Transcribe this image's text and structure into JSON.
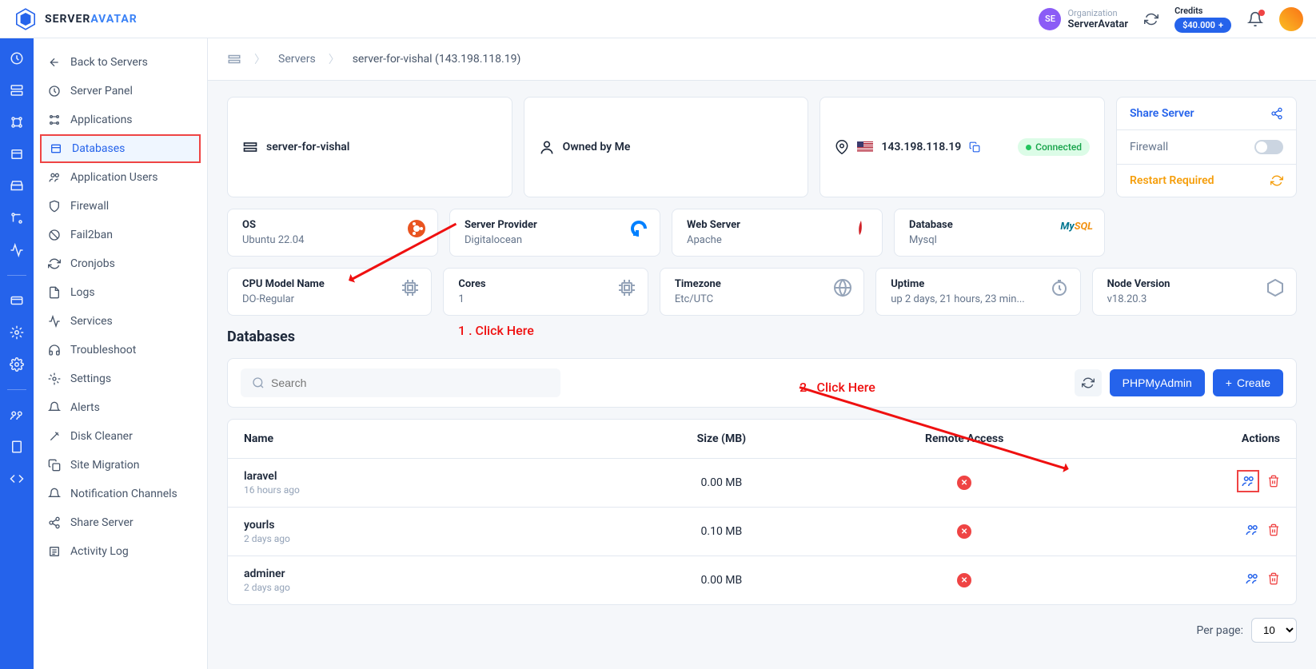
{
  "brand": {
    "server": "SERVER",
    "avatar": "AVATAR"
  },
  "topbar": {
    "org_label": "Organization",
    "org_name": "ServerAvatar",
    "org_badge": "SE",
    "credits_label": "Credits",
    "credits_value": "$40.000",
    "credits_plus": "+"
  },
  "breadcrumb": {
    "item1": "Servers",
    "item2": "server-for-vishal (143.198.118.19)"
  },
  "sidebar": {
    "back": "Back to Servers",
    "items": [
      "Server Panel",
      "Applications",
      "Databases",
      "Application Users",
      "Firewall",
      "Fail2ban",
      "Cronjobs",
      "Logs",
      "Services",
      "Troubleshoot",
      "Settings",
      "Alerts",
      "Disk Cleaner",
      "Site Migration",
      "Notification Channels",
      "Share Server",
      "Activity Log"
    ]
  },
  "server_info": {
    "name": "server-for-vishal",
    "owned": "Owned by Me",
    "ip": "143.198.118.19",
    "status": "Connected",
    "share": "Share Server",
    "firewall_label": "Firewall",
    "restart": "Restart Required"
  },
  "stats1": {
    "os_label": "OS",
    "os_value": "Ubuntu 22.04",
    "provider_label": "Server Provider",
    "provider_value": "Digitalocean",
    "webserver_label": "Web Server",
    "webserver_value": "Apache",
    "database_label": "Database",
    "database_value": "Mysql"
  },
  "stats2": {
    "cpu_label": "CPU Model Name",
    "cpu_value": "DO-Regular",
    "cores_label": "Cores",
    "cores_value": "1",
    "tz_label": "Timezone",
    "tz_value": "Etc/UTC",
    "uptime_label": "Uptime",
    "uptime_value": "up 2 days, 21 hours, 23 min...",
    "node_label": "Node Version",
    "node_value": "v18.20.3"
  },
  "section_title": "Databases",
  "search_placeholder": "Search",
  "buttons": {
    "phpmyadmin": "PHPMyAdmin",
    "create": "Create"
  },
  "table": {
    "headers": {
      "name": "Name",
      "size": "Size (MB)",
      "remote": "Remote Access",
      "actions": "Actions"
    },
    "rows": [
      {
        "name": "laravel",
        "time": "16 hours ago",
        "size": "0.00 MB"
      },
      {
        "name": "yourls",
        "time": "2 days ago",
        "size": "0.10 MB"
      },
      {
        "name": "adminer",
        "time": "2 days ago",
        "size": "0.00 MB"
      }
    ]
  },
  "per_page": {
    "label": "Per page:",
    "value": "10"
  },
  "annotations": {
    "click1": "1 . Click Here",
    "click2": "2 . Click Here"
  }
}
